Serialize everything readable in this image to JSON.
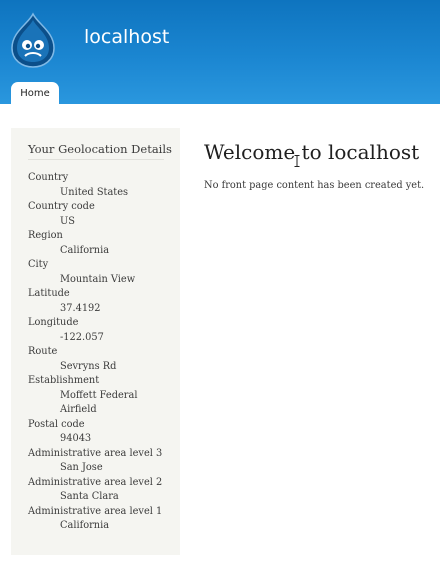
{
  "header": {
    "site_name": "localhost",
    "logo_icon": "drupal-drop-logo",
    "brand_color": "#1b86d1"
  },
  "tabs": [
    {
      "label": "Home"
    }
  ],
  "sidebar": {
    "title": "Your Geolocation Details",
    "fields": [
      {
        "label": "Country",
        "value": "United States"
      },
      {
        "label": "Country code",
        "value": "US"
      },
      {
        "label": "Region",
        "value": "California"
      },
      {
        "label": "City",
        "value": "Mountain View"
      },
      {
        "label": "Latitude",
        "value": "37.4192"
      },
      {
        "label": "Longitude",
        "value": "-122.057"
      },
      {
        "label": "Route",
        "value": "Sevryns Rd"
      },
      {
        "label": "Establishment",
        "value": "Moffett Federal Airfield"
      },
      {
        "label": "Postal code",
        "value": "94043"
      },
      {
        "label": "Administrative area level 3",
        "value": "San Jose"
      },
      {
        "label": "Administrative area level 2",
        "value": "Santa Clara"
      },
      {
        "label": "Administrative area level 1",
        "value": "California"
      }
    ]
  },
  "main": {
    "title": "Welcome to localhost",
    "text": "No front page content has been created yet."
  },
  "cursor_icon": "text-cursor-icon"
}
